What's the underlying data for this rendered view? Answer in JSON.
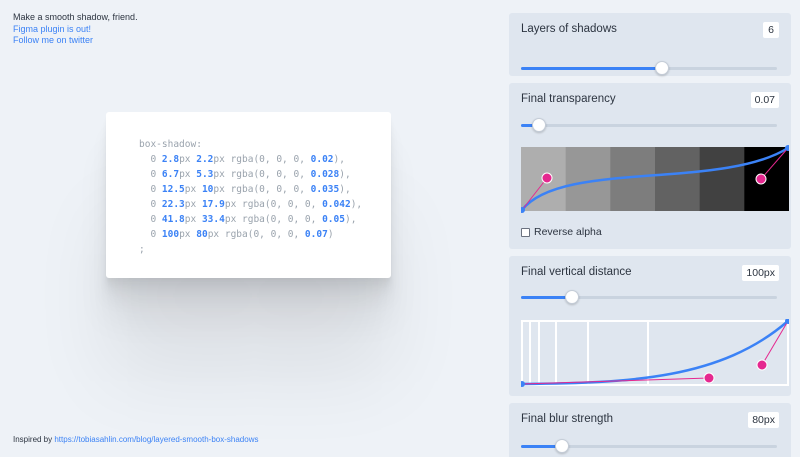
{
  "intro": {
    "tagline": "Make a smooth shadow, friend.",
    "figma_link": "Figma plugin is out!",
    "twitter_link": "Follow me on twitter"
  },
  "code": {
    "header": "box-shadow:",
    "rows": [
      {
        "a": "2.8",
        "b": "2.2",
        "alpha": "0.02",
        "end": ","
      },
      {
        "a": "6.7",
        "b": "5.3",
        "alpha": "0.028",
        "end": ","
      },
      {
        "a": "12.5",
        "b": "10",
        "alpha": "0.035",
        "end": ","
      },
      {
        "a": "22.3",
        "b": "17.9",
        "alpha": "0.042",
        "end": ","
      },
      {
        "a": "41.8",
        "b": "33.4",
        "alpha": "0.05",
        "end": ","
      },
      {
        "a": "100",
        "b": "80",
        "alpha": "0.07",
        "end": ""
      }
    ],
    "footer": ";"
  },
  "footer": {
    "prefix": "Inspired by ",
    "link": "https://tobiasahlin.com/blog/layered-smooth-box-shadows"
  },
  "controls": {
    "layers": {
      "label": "Layers of shadows",
      "value": "6",
      "fraction": 0.55
    },
    "transparency": {
      "label": "Final transparency",
      "value": "0.07",
      "fraction": 0.07
    },
    "reverse_alpha": {
      "label": "Reverse alpha",
      "checked": false
    },
    "distance": {
      "label": "Final vertical distance",
      "value": "100px",
      "fraction": 0.2
    },
    "blur": {
      "label": "Final blur strength",
      "value": "80px",
      "fraction": 0.16
    }
  },
  "colors": {
    "accent": "#3b82f6",
    "handle": "#e5288f",
    "swatches": [
      "#aeaeae",
      "#979797",
      "#7d7d7d",
      "#626262",
      "#414141",
      "#000000"
    ]
  }
}
